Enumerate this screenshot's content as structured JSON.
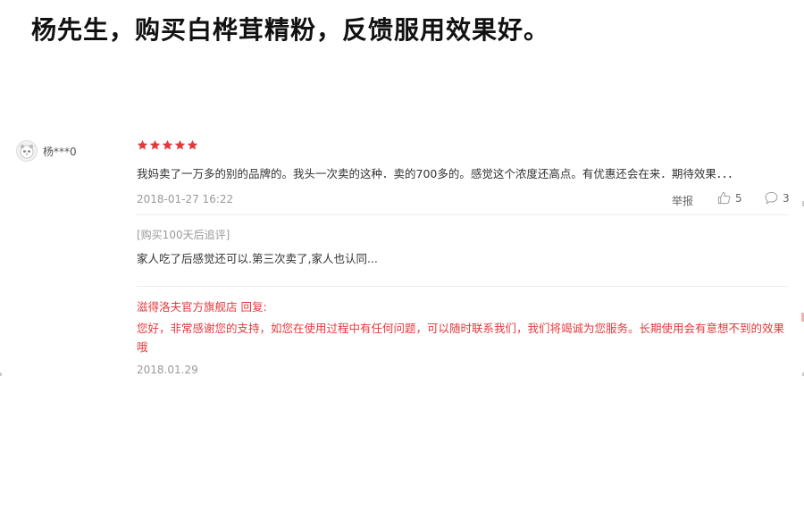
{
  "headline": "杨先生，购买白桦茸精粉，反馈服用效果好。",
  "review": {
    "username": "杨***0",
    "rating": 5,
    "rating_max": 5,
    "text": "我妈卖了一万多的别的品牌的。我头一次卖的这种．卖的700多的。感觉这个浓度还高点。有优惠还会在来．期待效果．．．",
    "date": "2018-01-27 16:22",
    "report_label": "举报",
    "likes": "5",
    "comments": "3",
    "append_label": "[购买100天后追评]",
    "append_text": "家人吃了后感觉还可以.第三次卖了,家人也认同...",
    "reply_head": "滋得洛夫官方旗舰店 回复:",
    "reply_text": "您好，非常感谢您的支持，如您在使用过程中有任何问题，可以随时联系我们，我们将竭诚为您服务。长期使用会有意想不到的效果哦",
    "reply_date": "2018.01.29"
  },
  "colors": {
    "star": "#e4393c",
    "reply": "#e4393c",
    "meta": "#999999"
  }
}
